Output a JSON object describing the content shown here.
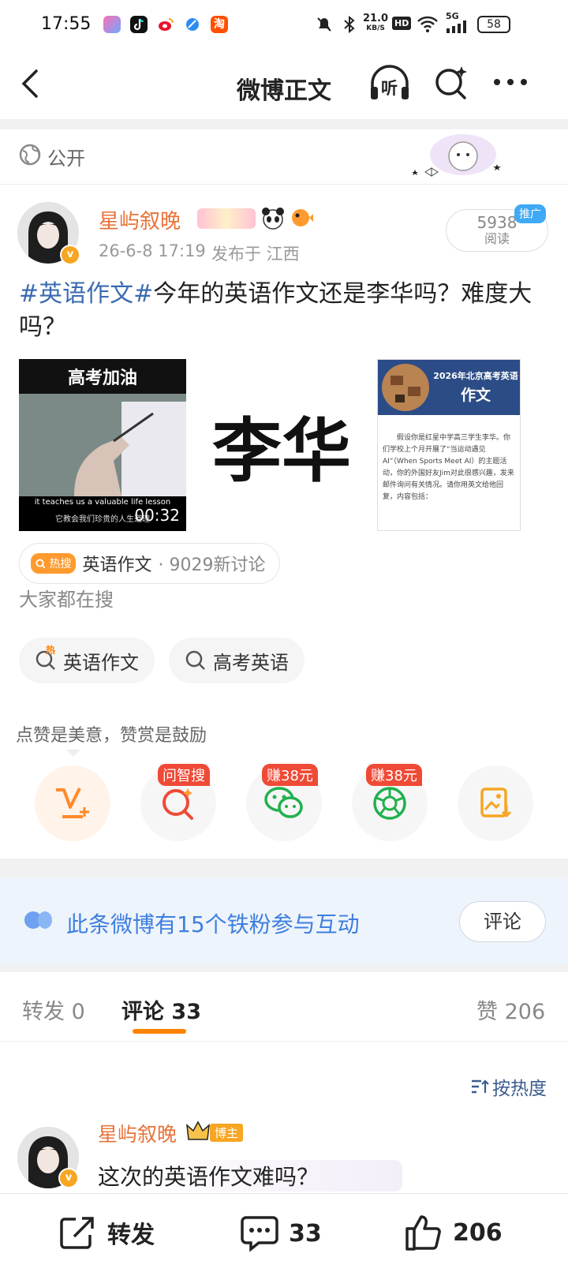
{
  "status": {
    "time": "17:55",
    "net_speed": "21.0",
    "net_unit": "KB/S",
    "hd": "HD",
    "signal": "5G",
    "battery": "58"
  },
  "nav": {
    "title": "微博正文",
    "listen_label": "听"
  },
  "visibility": "公开",
  "post": {
    "username": "星屿叙晚",
    "time": "26-6-8 17:19",
    "location": "发布于 江西",
    "reads": "5938",
    "reads_label": "阅读",
    "ad_tag": "推广",
    "topic": "#英语作文#",
    "text": "今年的英语作文还是李华吗？难度大吗？",
    "video": {
      "caption_top": "高考加油",
      "subtitle_en": "it teaches us a valuable life lesson",
      "subtitle_zh": "它教会我们珍贵的人生道理",
      "duration": "00:32"
    },
    "image_text": "李华",
    "doc": {
      "title": "2026年北京高考英语",
      "subtitle": "作文",
      "body": "假设你是红星中学高三学生李华。你们学校上个月开展了“当运动遇见AI”（When Sports Meet AI）的主题活动，你的外国好友Jim对此很感兴趣，发来邮件询问有关情况。请你用英文给他回复，内容包括："
    }
  },
  "hot": {
    "badge": "热搜",
    "topic": "英语作文",
    "count": "· 9029新讨论"
  },
  "search": {
    "heading": "大家都在搜",
    "chips": [
      "英语作文",
      "高考英语"
    ],
    "hot_mark": "热"
  },
  "share": {
    "prompt": "点赞是美意，赞赏是鼓励",
    "badges": [
      "问智搜",
      "赚38元",
      "赚38元"
    ]
  },
  "fans": {
    "text": "此条微博有15个铁粉参与互动",
    "button": "评论"
  },
  "tabs": {
    "repost": "转发",
    "repost_count": "0",
    "comment": "评论",
    "comment_count": "33",
    "like": "赞",
    "like_count": "206"
  },
  "sort": "按热度",
  "comment": {
    "username": "星屿叙晚",
    "role": "博主",
    "text": "这次的英语作文难吗？"
  },
  "bottom": {
    "repost": "转发",
    "comments": "33",
    "likes": "206"
  },
  "colors": {
    "orange": "#ff8200",
    "username": "#e8733a",
    "topic": "#3b6bb0",
    "blue": "#3e7fe0",
    "red_badge": "#ef4a36"
  }
}
